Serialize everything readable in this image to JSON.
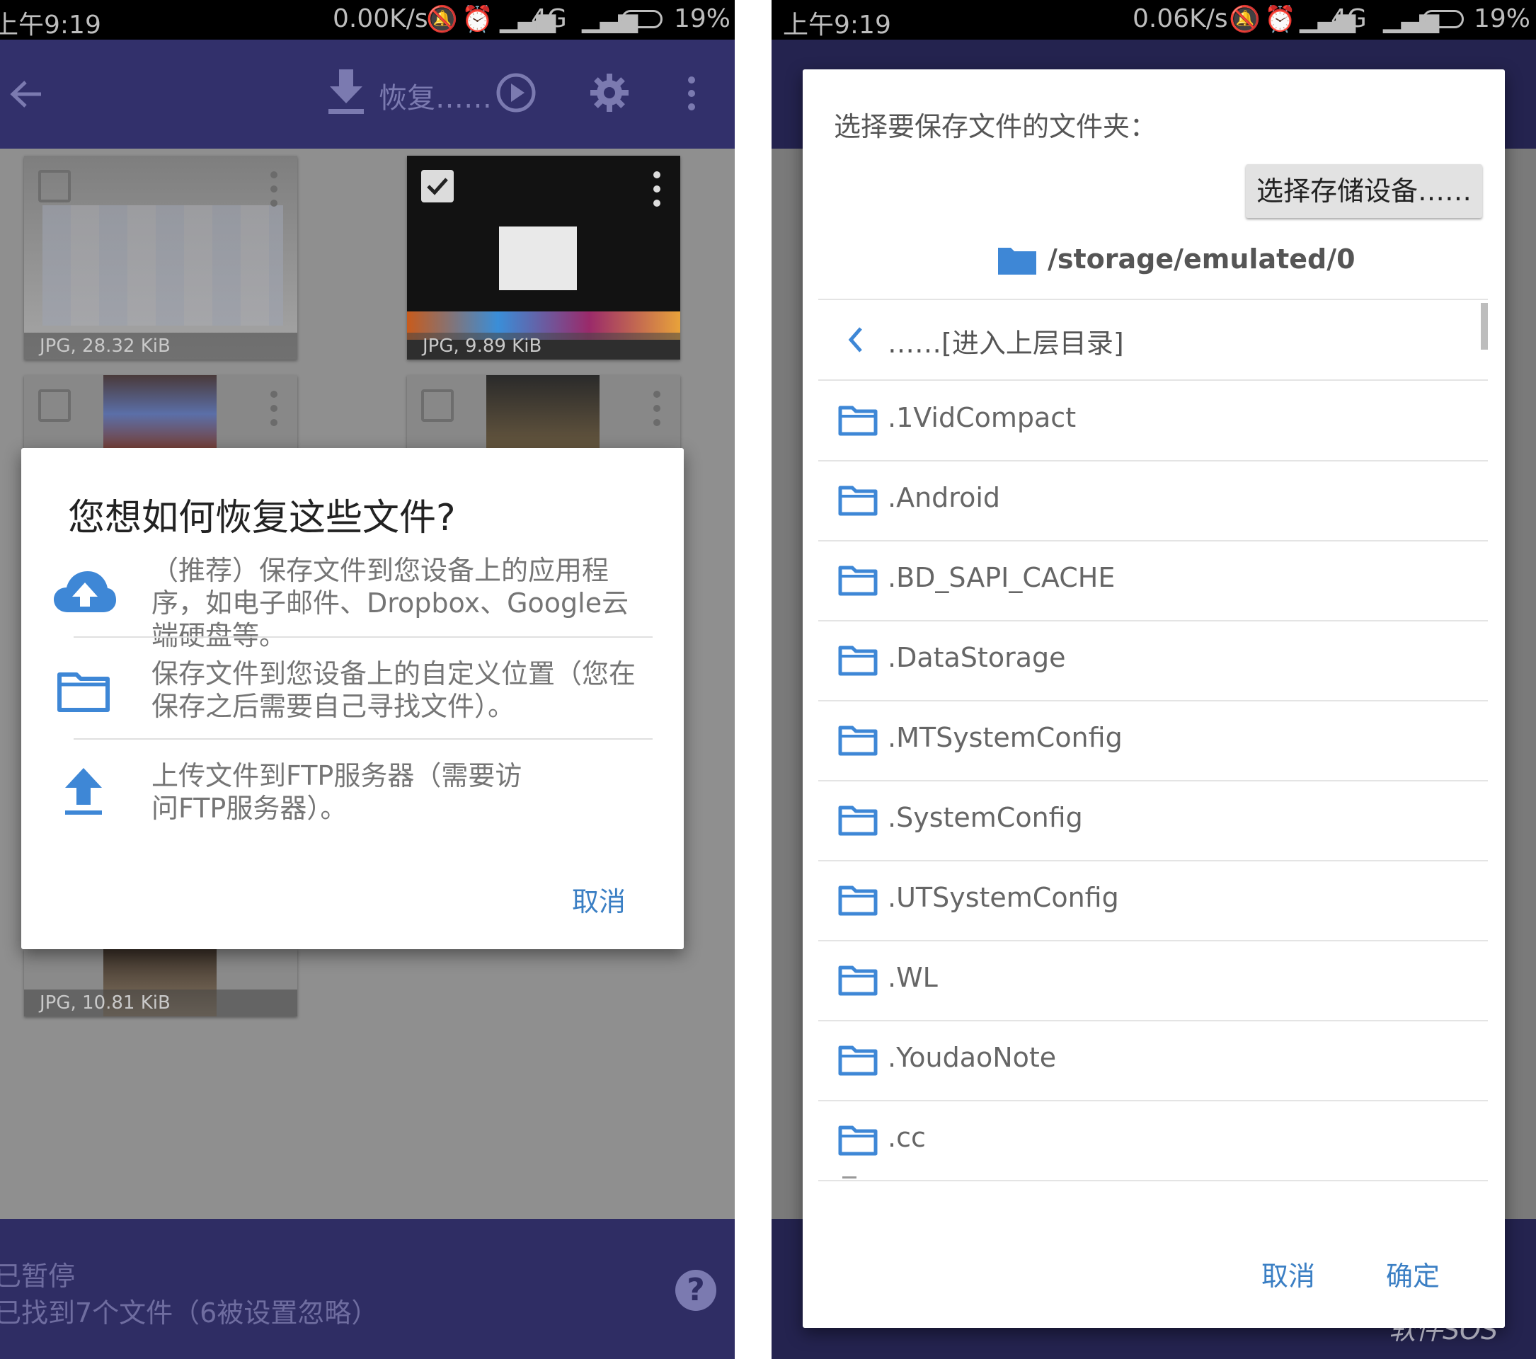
{
  "left": {
    "status": {
      "time": "上午9:19",
      "right": "0.00K/s",
      "network": "4G",
      "battery": "19%"
    },
    "toolbar": {
      "restore_label": "恢复……"
    },
    "thumbs": [
      {
        "caption": "JPG, 28.32 KiB"
      },
      {
        "caption": "JPG, 9.89 KiB"
      },
      {
        "caption": ""
      },
      {
        "caption": ""
      },
      {
        "caption": "JPG, 10.81 KiB"
      }
    ],
    "dialog": {
      "title": "您想如何恢复这些文件?",
      "options": [
        {
          "text": "（推荐）保存文件到您设备上的应用程序，如电子邮件、Dropbox、Google云端硬盘等。",
          "icon": "cloud-upload-icon"
        },
        {
          "text": "保存文件到您设备上的自定义位置（您在保存之后需要自己寻找文件）。",
          "icon": "folder-icon"
        },
        {
          "text": "上传文件到FTP服务器（需要访问FTP服务器）。",
          "icon": "upload-icon"
        }
      ],
      "cancel": "取消"
    },
    "bottom": {
      "line1": "已暂停",
      "line2": "已找到7个文件（6被设置忽略）",
      "help": "?"
    }
  },
  "right": {
    "status": {
      "time": "上午9:19",
      "speed": "0.06K/s",
      "network": "4G",
      "battery": "19%"
    },
    "dialog": {
      "title": "选择要保存文件的文件夹：",
      "storage_button": "选择存储设备……",
      "path": "/storage/emulated/0",
      "parent": "……[进入上层目录]",
      "folders": [
        ".1VidCompact",
        ".Android",
        ".BD_SAPI_CACHE",
        ".DataStorage",
        ".MTSystemConfig",
        ".SystemConfig",
        ".UTSystemConfig",
        ".WL",
        ".YoudaoNote",
        ".cc"
      ],
      "cancel": "取消",
      "ok": "确定"
    },
    "watermark": "软件SOS"
  },
  "colors": {
    "accent": "#3b7fc4",
    "toolbar": "#32306b",
    "icon_blue": "#3e87d6"
  }
}
